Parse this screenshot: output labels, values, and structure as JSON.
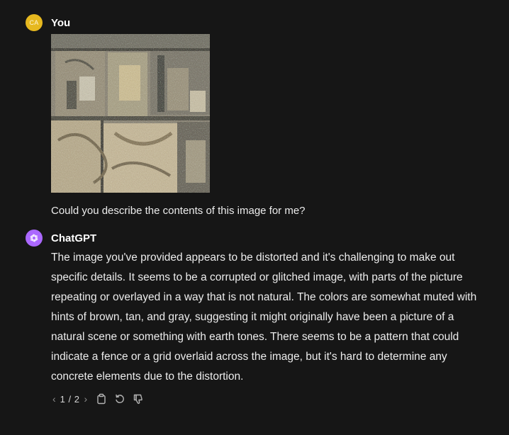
{
  "user_message": {
    "avatar_initials": "CA",
    "author": "You",
    "image_icon": "distorted-photo",
    "text": "Could you describe the contents of this image for me?"
  },
  "assistant_message": {
    "author": "ChatGPT",
    "avatar_icon": "openai-logo-icon",
    "text": "The image you've provided appears to be distorted and it's challenging to make out specific details. It seems to be a corrupted or glitched image, with parts of the picture repeating or overlayed in a way that is not natural. The colors are somewhat muted with hints of brown, tan, and gray, suggesting it might originally have been a picture of a natural scene or something with earth tones. There seems to be a pattern that could indicate a fence or a grid overlaid across the image, but it's hard to determine any concrete elements due to the distortion.",
    "pager": {
      "label": "1 / 2",
      "prev_icon": "chevron-left-icon",
      "next_icon": "chevron-right-icon"
    },
    "actions": [
      "copy-icon",
      "regenerate-icon",
      "thumbs-down-icon"
    ]
  },
  "colors": {
    "background": "#161616",
    "user_avatar": "#e6b81f",
    "assistant_avatar": "#ab68ff",
    "text": "#ececec",
    "muted": "#b4b4b4"
  }
}
